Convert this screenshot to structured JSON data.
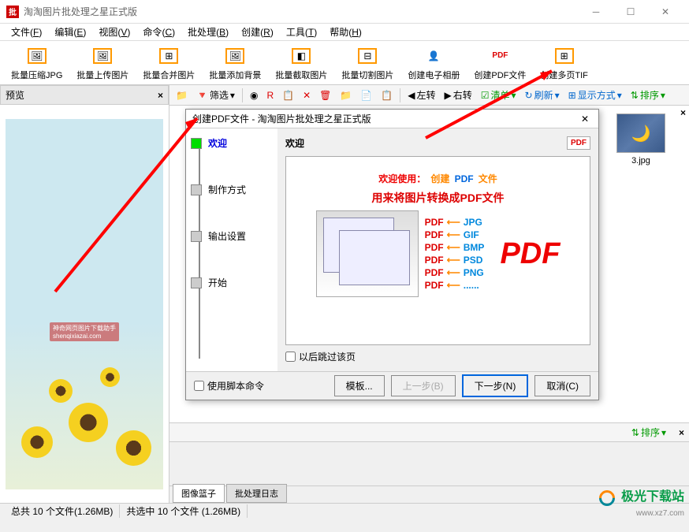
{
  "window": {
    "title": "淘淘图片批处理之星正式版",
    "icon_text": "批"
  },
  "menus": [
    {
      "label": "文件",
      "key": "F"
    },
    {
      "label": "编辑",
      "key": "E"
    },
    {
      "label": "视图",
      "key": "V"
    },
    {
      "label": "命令",
      "key": "C"
    },
    {
      "label": "批处理",
      "key": "B"
    },
    {
      "label": "创建",
      "key": "R"
    },
    {
      "label": "工具",
      "key": "T"
    },
    {
      "label": "帮助",
      "key": "H"
    }
  ],
  "toolbar": [
    {
      "label": "批量压缩JPG"
    },
    {
      "label": "批量上传图片"
    },
    {
      "label": "批量合并图片"
    },
    {
      "label": "批量添加背景"
    },
    {
      "label": "批量截取图片"
    },
    {
      "label": "批量切割图片"
    },
    {
      "label": "创建电子相册"
    },
    {
      "label": "创建PDF文件",
      "badge": "PDF"
    },
    {
      "label": "创建多页TIF"
    }
  ],
  "preview": {
    "title": "预览"
  },
  "sec_toolbar": {
    "filter": "筛选",
    "rotate_left": "左转",
    "rotate_right": "右转",
    "clear": "清单",
    "refresh": "刷新",
    "display_mode": "显示方式",
    "sort": "排序"
  },
  "thumb": {
    "label": "3.jpg"
  },
  "mid_toolbar": {
    "sort": "排序"
  },
  "tabs": {
    "basket": "图像篮子",
    "log": "批处理日志"
  },
  "status": {
    "total": "总共 10 个文件(1.26MB)",
    "selected": "共选中 10 个文件 (1.26MB)"
  },
  "dialog": {
    "title": "创建PDF文件 - 淘淘图片批处理之星正式版",
    "nav": [
      {
        "label": "欢迎",
        "active": true
      },
      {
        "label": "制作方式"
      },
      {
        "label": "输出设置"
      },
      {
        "label": "开始"
      }
    ],
    "heading": "欢迎",
    "pdf_badge": "PDF",
    "welcome": {
      "text1": "欢迎使用：",
      "text2": "创建",
      "text3": "PDF",
      "text4": "文件"
    },
    "subtitle": "用来将图片转换成PDF文件",
    "formats": [
      "JPG",
      "GIF",
      "BMP",
      "PSD",
      "PNG",
      "......"
    ],
    "pdf_label": "PDF",
    "big_pdf": "PDF",
    "skip_check": "以后跳过该页",
    "script_check": "使用脚本命令",
    "buttons": {
      "template": "模板...",
      "prev": "上一步(B)",
      "next": "下一步(N)",
      "cancel": "取消(C)"
    }
  },
  "watermark": {
    "name": "极光下载站",
    "url": "www.xz7.com"
  }
}
